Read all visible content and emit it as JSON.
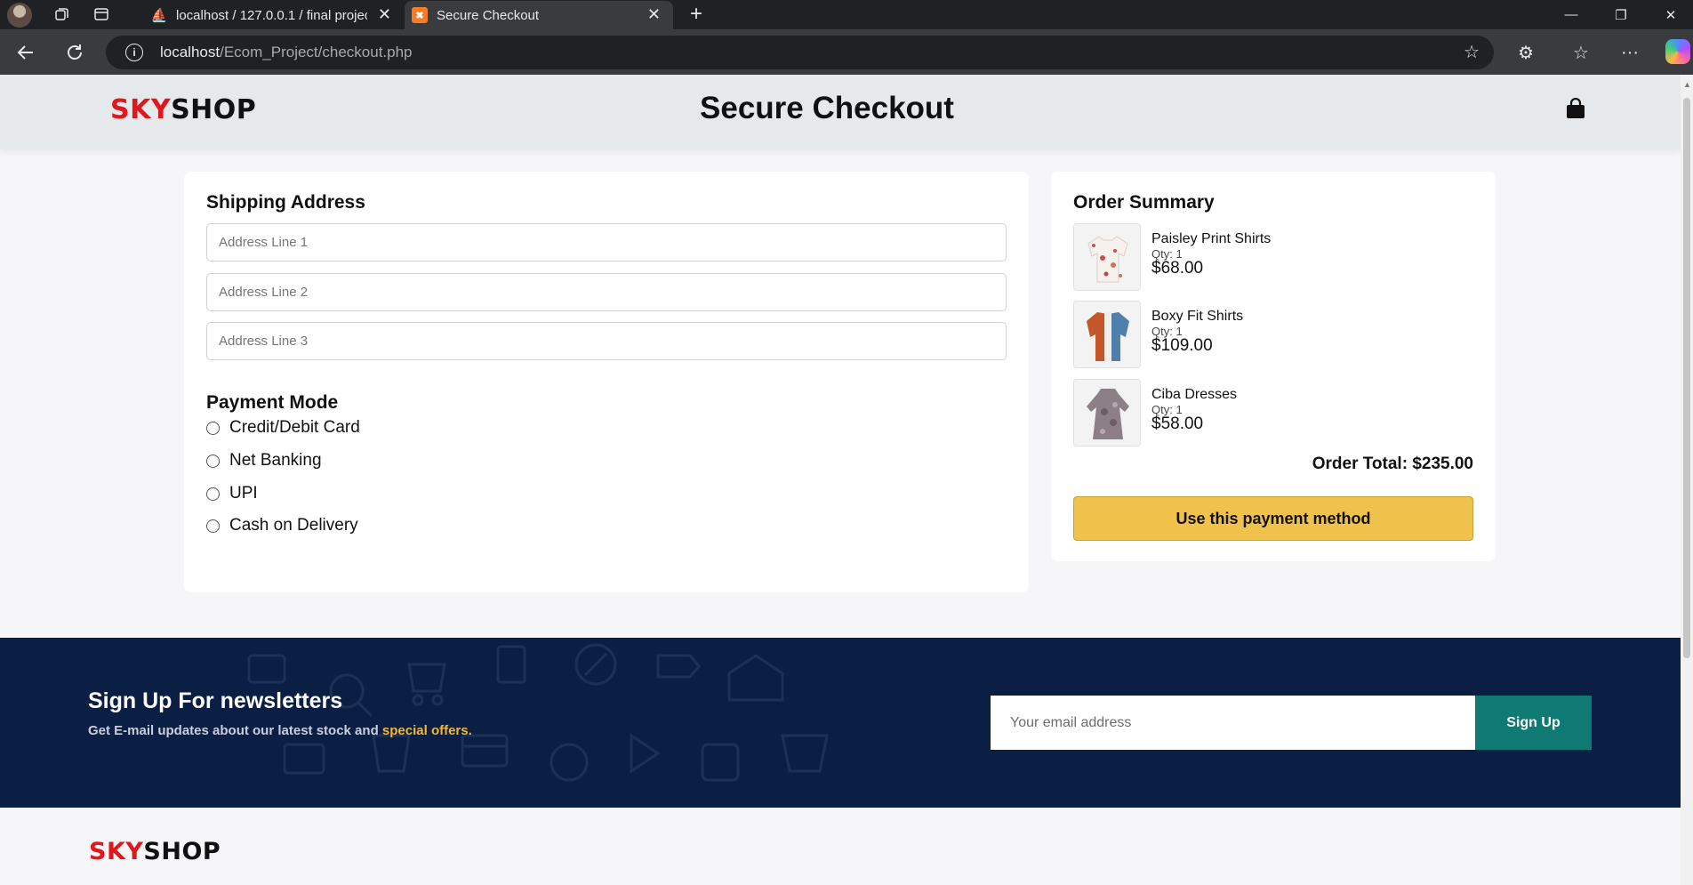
{
  "browser": {
    "tabs": [
      {
        "title": "localhost / 127.0.0.1 / final project | phpMyAdmin",
        "active": false
      },
      {
        "title": "Secure Checkout",
        "active": true
      }
    ],
    "url_host": "localhost",
    "url_path": "/Ecom_Project/checkout.php"
  },
  "header": {
    "logo_part1": "SKY",
    "logo_part2": "SHOP",
    "title": "Secure Checkout",
    "cart_icon": "shopping-bag-icon"
  },
  "shipping": {
    "title": "Shipping Address",
    "fields": [
      {
        "placeholder": "Address Line 1",
        "value": ""
      },
      {
        "placeholder": "Address Line 2",
        "value": ""
      },
      {
        "placeholder": "Address Line 3",
        "value": ""
      }
    ]
  },
  "payment": {
    "title": "Payment Mode",
    "options": [
      "Credit/Debit Card",
      "Net Banking",
      "UPI",
      "Cash on Delivery"
    ],
    "selected": null
  },
  "summary": {
    "title": "Order Summary",
    "items": [
      {
        "name": "Paisley Print Shirts",
        "qty": "Qty: 1",
        "price": "$68.00"
      },
      {
        "name": "Boxy Fit Shirts",
        "qty": "Qty: 1",
        "price": "$109.00"
      },
      {
        "name": "Ciba Dresses",
        "qty": "Qty: 1",
        "price": "$58.00"
      }
    ],
    "total": "Order Total: $235.00",
    "button": "Use this payment method"
  },
  "newsletter": {
    "title": "Sign Up For newsletters",
    "subtitle": "Get E-mail updates about our latest stock and ",
    "subtitle_highlight": "special offers.",
    "placeholder": "Your email address",
    "button": "Sign Up"
  },
  "footer": {
    "logo_part1": "SKY",
    "logo_part2": "SHOP"
  },
  "colors": {
    "brand_red": "#e1171e",
    "checkout_button": "#f0c14b",
    "newsletter_bg": "#0b1f44",
    "signup_button": "#0e7a73",
    "highlight": "#f5b72f"
  }
}
